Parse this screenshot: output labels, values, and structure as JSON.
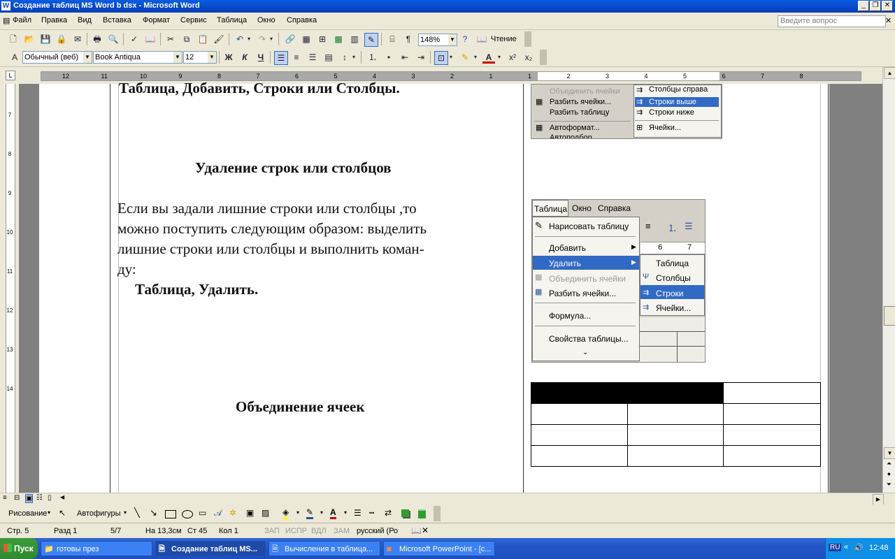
{
  "window": {
    "title": "Создание таблиц MS Word b dsx - Microsoft Word"
  },
  "menu": [
    "Файл",
    "Правка",
    "Вид",
    "Вставка",
    "Формат",
    "Сервис",
    "Таблица",
    "Окно",
    "Справка"
  ],
  "ask_placeholder": "Введите вопрос",
  "toolbar1": {
    "zoom": "148%",
    "reading_label": "Чтение"
  },
  "toolbar2": {
    "style": "Обычный (веб)",
    "font": "Book Antiqua",
    "size": "12",
    "bold": "Ж",
    "italic": "К",
    "underline": "Ч"
  },
  "doc": {
    "top_line": "Таблица, Добавить, Строки или Столбцы.",
    "heading_delete": "Удаление строк или столбцов",
    "para_lines": [
      "Если вы задали лишние строки или столбцы ,то",
      "можно поступить следующим образом: выделить",
      "лишние строки или столбцы и выполнить коман-",
      "ду:"
    ],
    "command": "Таблица, Удалить.",
    "heading_merge": "Объединение ячеек"
  },
  "shot1": {
    "left_items": [
      "Объединить ячейки",
      "Разбить ячейки...",
      "Разбить таблицу",
      "Автоформат...",
      "Автоподбор"
    ],
    "right_items": [
      "Столбцы справа",
      "Строки выше",
      "Строки ниже",
      "Ячейки..."
    ]
  },
  "shot2": {
    "menubar": [
      "Таблица",
      "Окно",
      "Справка"
    ],
    "items": [
      "Нарисовать таблицу",
      "Добавить",
      "Удалить",
      "Объединить ячейки",
      "Разбить ячейки...",
      "Формула...",
      "Свойства таблицы..."
    ],
    "submenu": [
      "Таблица",
      "Столбцы",
      "Строки",
      "Ячейки..."
    ],
    "ruler_nums": [
      "6",
      "7"
    ]
  },
  "ruler_numbers": [
    "12",
    "11",
    "10",
    "9",
    "8",
    "7",
    "6",
    "5",
    "4",
    "3",
    "2",
    "1",
    "1",
    "2",
    "3",
    "4",
    "5",
    "6",
    "7",
    "8"
  ],
  "vruler_numbers": [
    "7",
    "8",
    "9",
    "10",
    "11",
    "12",
    "13",
    "14"
  ],
  "drawbar": {
    "drawing": "Рисование",
    "autoshapes": "Автофигуры"
  },
  "status": {
    "page": "Стр. 5",
    "section": "Разд 1",
    "pages": "5/7",
    "at": "На 13,3см",
    "line": "Ст 45",
    "col": "Кол 1",
    "rec": "ЗАП",
    "trk": "ИСПР",
    "ext": "ВДЛ",
    "ovr": "ЗАМ",
    "lang": "русский (Ро"
  },
  "taskbar": {
    "start": "Пуск",
    "tasks": [
      "готовы през",
      "Создание таблиц MS...",
      "Вычисления в таблица...",
      "Microsoft PowerPoint - [с..."
    ],
    "lang": "RU",
    "time": "12:48"
  }
}
